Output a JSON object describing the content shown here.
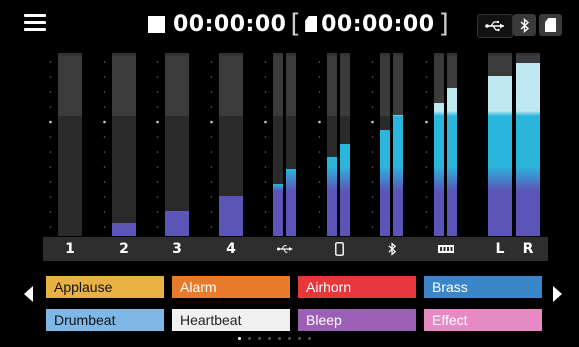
{
  "header": {
    "timer": "00:00:00",
    "sd_remaining": "00:00:00",
    "bracket_open": "[",
    "bracket_close": "]"
  },
  "status_icons": [
    "usb-icon",
    "bluetooth-icon",
    "sd-card-icon"
  ],
  "meters": {
    "channels": [
      {
        "label": "1",
        "kind": "text",
        "levels": [
          0
        ]
      },
      {
        "label": "2",
        "kind": "text",
        "levels": [
          0.07
        ]
      },
      {
        "label": "3",
        "kind": "text",
        "levels": [
          0.14
        ]
      },
      {
        "label": "4",
        "kind": "text",
        "levels": [
          0.22
        ]
      },
      {
        "label": "",
        "kind": "usb-icon",
        "levels": [
          0.29,
          0.37
        ]
      },
      {
        "label": "",
        "kind": "phone-icon",
        "levels": [
          0.44,
          0.51
        ]
      },
      {
        "label": "",
        "kind": "bluetooth-icon",
        "levels": [
          0.59,
          0.67
        ]
      },
      {
        "label": "",
        "kind": "line-input-icon",
        "levels": [
          0.74,
          0.82
        ]
      },
      {
        "label": "L",
        "kind": "text",
        "levels": [
          0.89
        ]
      },
      {
        "label": "R",
        "kind": "text",
        "levels": [
          0.96
        ]
      }
    ],
    "colors": {
      "low": "#5b55b8",
      "mid": "#2ab6dc",
      "high": "#bfe8f0"
    }
  },
  "effects": {
    "pads": [
      {
        "label": "Applause",
        "color": "#e8b143"
      },
      {
        "label": "Alarm",
        "color": "#e87a2b"
      },
      {
        "label": "Airhorn",
        "color": "#e8363d"
      },
      {
        "label": "Brass",
        "color": "#3a86c8"
      },
      {
        "label": "Drumbeat",
        "color": "#7fb8e6"
      },
      {
        "label": "Heartbeat",
        "color": "#f0f0f0"
      },
      {
        "label": "Bleep",
        "color": "#9b5fb5"
      },
      {
        "label": "Effect",
        "color": "#e58ac3"
      }
    ],
    "page_count": 8,
    "current_page": 1
  }
}
